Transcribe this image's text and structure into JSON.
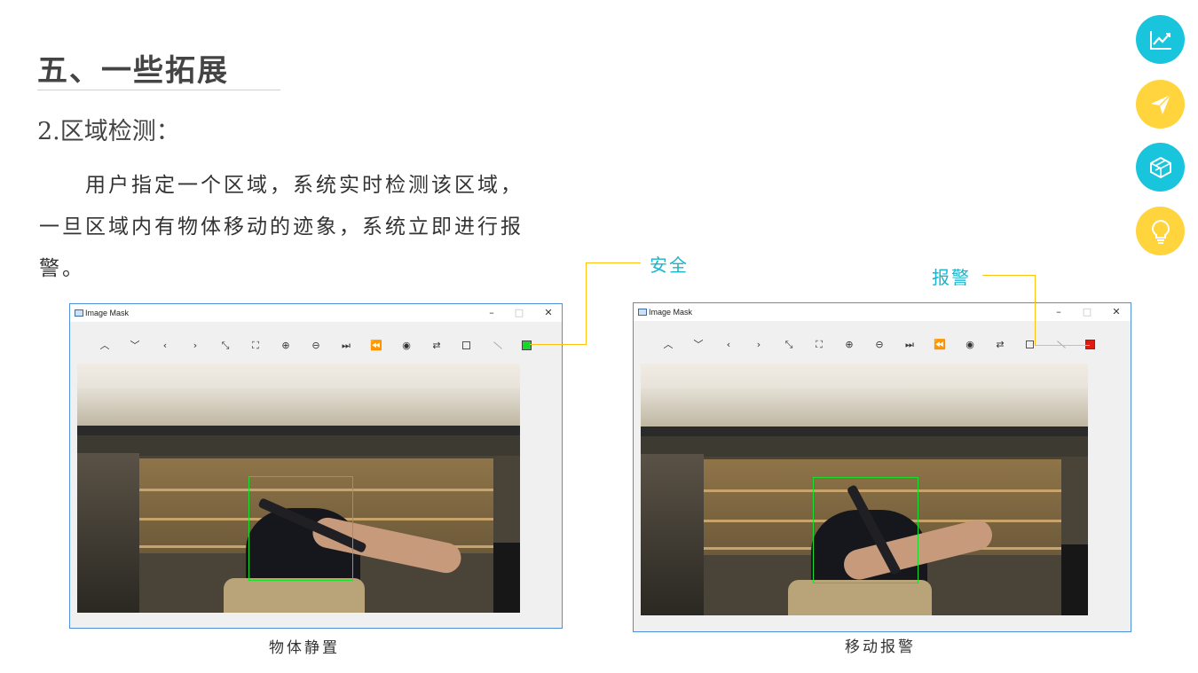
{
  "slide": {
    "heading": "五、一些拓展",
    "subheading": "2.区域检测：",
    "body": "用户指定一个区域，系统实时检测该区域，一旦区域内有物体移动的迹象，系统立即进行报警。"
  },
  "sidebar": {
    "buttons": [
      {
        "icon": "trend-chart-icon",
        "color": "#18c5dc"
      },
      {
        "icon": "paper-plane-icon",
        "color": "#ffd43c"
      },
      {
        "icon": "cube-icon",
        "color": "#18c5dc"
      },
      {
        "icon": "lightbulb-icon",
        "color": "#ffd43c"
      }
    ]
  },
  "windows": [
    {
      "title": "Image Mask",
      "controls": {
        "minimize": "–",
        "maximize": "□",
        "close": "✕"
      },
      "status_color": "#19d62a",
      "callout": "安全",
      "caption": "物体静置"
    },
    {
      "title": "Image Mask",
      "controls": {
        "minimize": "–",
        "maximize": "□",
        "close": "✕"
      },
      "status_color": "#e01b10",
      "callout": "报警",
      "caption": "移动报警"
    }
  ],
  "toolbar_icons": [
    "chevron-up-icon",
    "chevron-down-icon",
    "chevron-left-icon",
    "chevron-right-icon",
    "collapse-icon",
    "expand-icon",
    "zoom-in-icon",
    "zoom-out-icon",
    "fast-forward-icon",
    "rewind-icon",
    "record-icon",
    "swap-icon",
    "square-icon",
    "diagonal-icon",
    "status-led"
  ],
  "toolbar_glyphs": [
    "︿",
    "﹀",
    "‹",
    "›",
    "⤡",
    "⛶",
    "⊕",
    "⊖",
    "⏭",
    "⏪",
    "◉",
    "⇄",
    "",
    "",
    ""
  ],
  "colors": {
    "accent": "#1ab4cc",
    "connector": "#ffc20e",
    "roi": "#19e02a"
  }
}
